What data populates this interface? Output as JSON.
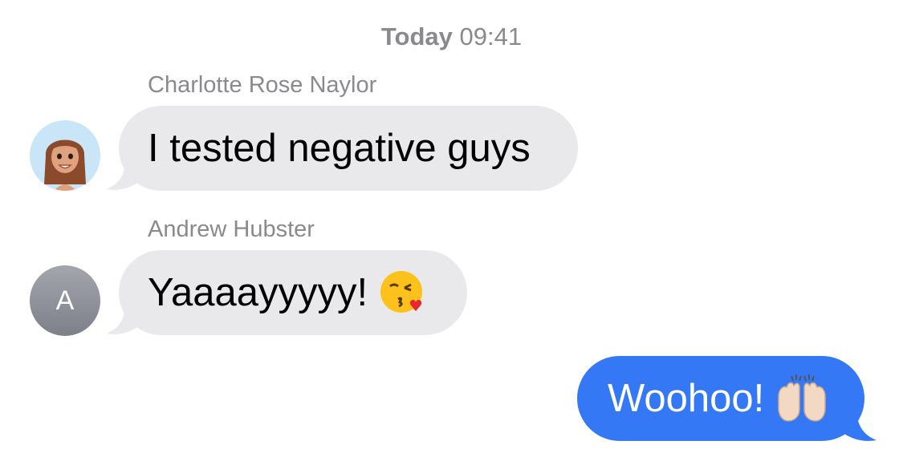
{
  "timestamp": {
    "day": "Today",
    "time": "09:41"
  },
  "messages": [
    {
      "sender": "Charlotte Rose Naylor",
      "avatar_icon": "memoji-avatar-icon",
      "text": "I tested negative guys"
    },
    {
      "sender": "Andrew Hubster",
      "avatar_initial": "A",
      "text": "Yaaaayyyyy!",
      "emoji_icon": "face-blowing-kiss-icon"
    },
    {
      "sender": "me",
      "text": "Woohoo!",
      "emoji_icon": "raising-hands-icon"
    }
  ],
  "colors": {
    "received_bubble": "#e9e9eb",
    "sent_bubble": "#3478f6",
    "meta_text": "#8a8a8e"
  }
}
